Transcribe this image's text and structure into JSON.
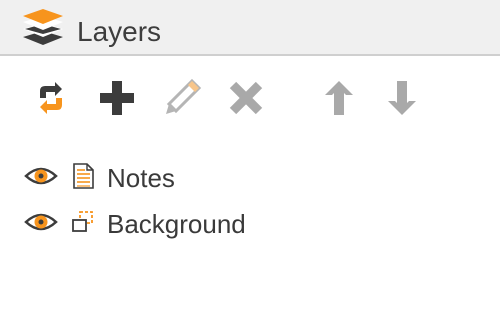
{
  "panel": {
    "title": "Layers",
    "title_icon": "layers-stack-icon"
  },
  "toolbar": {
    "buttons": [
      {
        "name": "refresh-layers-button",
        "icon": "sync-arrows-icon",
        "enabled": true
      },
      {
        "name": "add-layer-button",
        "icon": "plus-icon",
        "enabled": true
      },
      {
        "name": "edit-layer-button",
        "icon": "pencil-icon",
        "enabled": false
      },
      {
        "name": "delete-layer-button",
        "icon": "x-icon",
        "enabled": false
      },
      {
        "name": "move-layer-up-button",
        "icon": "arrow-up-icon",
        "enabled": false
      },
      {
        "name": "move-layer-down-button",
        "icon": "arrow-down-icon",
        "enabled": false
      }
    ]
  },
  "layers": [
    {
      "label": "Notes",
      "visible": true,
      "type_icon": "document-icon"
    },
    {
      "label": "Background",
      "visible": true,
      "type_icon": "image-layer-icon"
    }
  ],
  "colors": {
    "accent": "#f7941d",
    "dark_icon": "#3c3c3c",
    "disabled_icon": "#a9a9a9",
    "header_bg": "#f0f0f0"
  }
}
